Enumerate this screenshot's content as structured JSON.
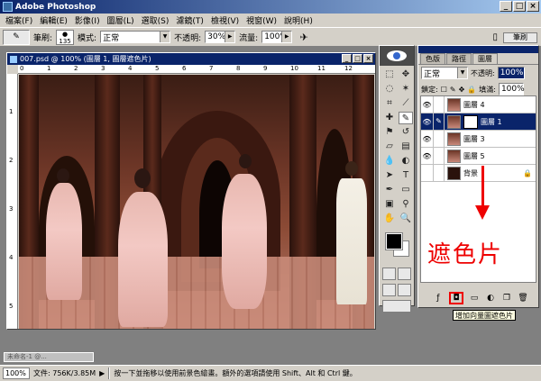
{
  "app": {
    "title": "Adobe Photoshop"
  },
  "menu": [
    "檔案(F)",
    "編輯(E)",
    "影像(I)",
    "圖層(L)",
    "選取(S)",
    "濾鏡(T)",
    "檢視(V)",
    "視窗(W)",
    "說明(H)"
  ],
  "options": {
    "brush_label": "筆刷:",
    "brush_size": "135",
    "mode_label": "模式:",
    "mode_value": "正常",
    "opacity_label": "不透明:",
    "opacity_value": "30%",
    "flow_label": "流量:",
    "flow_value": "100%",
    "palette_tab": "筆刷"
  },
  "document": {
    "title": "007.psd @ 100% (圖層 1, 圖層遮色片)",
    "ruler_h": [
      "0",
      "1",
      "2",
      "3",
      "4",
      "5",
      "6",
      "7",
      "8",
      "9",
      "10",
      "11",
      "12"
    ],
    "ruler_v": [
      "1",
      "2",
      "3",
      "4",
      "5"
    ]
  },
  "layers_palette": {
    "tabs": [
      "色版",
      "路徑",
      "圖層"
    ],
    "blend_mode": "正常",
    "opacity_label": "不透明:",
    "opacity_value": "100%",
    "lock_label": "鎖定:",
    "fill_label": "填滿:",
    "fill_value": "100%",
    "layers": [
      {
        "name": "圖層 4",
        "visible": true,
        "selected": false
      },
      {
        "name": "圖層 1",
        "visible": true,
        "selected": true,
        "has_mask": true
      },
      {
        "name": "圖層 3",
        "visible": true,
        "selected": false
      },
      {
        "name": "圖層 5",
        "visible": true,
        "selected": false
      },
      {
        "name": "背景",
        "visible": false,
        "selected": false,
        "locked": true
      }
    ],
    "tooltip": "增加向量圖遮色片"
  },
  "annotation": {
    "text": "遮色片",
    "color": "#ee0000"
  },
  "minimized_doc": "未命名-1 @...",
  "status": {
    "zoom": "100%",
    "doc_size": "文件: 756K/3.85M",
    "hint": "按一下並拖移以使用前景色繪畫。額外的選項請使用 Shift、Alt 和 Ctrl 鍵。"
  }
}
